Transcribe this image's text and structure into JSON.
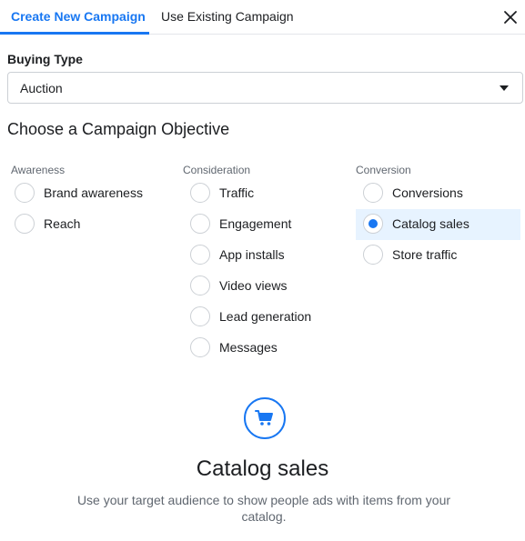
{
  "tabs": [
    {
      "label": "Create New Campaign",
      "active": true
    },
    {
      "label": "Use Existing Campaign",
      "active": false
    }
  ],
  "close_icon": "close-icon",
  "buying_type": {
    "label": "Buying Type",
    "value": "Auction"
  },
  "objective_title": "Choose a Campaign Objective",
  "columns": {
    "awareness": {
      "heading": "Awareness",
      "options": [
        "Brand awareness",
        "Reach"
      ]
    },
    "consideration": {
      "heading": "Consideration",
      "options": [
        "Traffic",
        "Engagement",
        "App installs",
        "Video views",
        "Lead generation",
        "Messages"
      ]
    },
    "conversion": {
      "heading": "Conversion",
      "options": [
        "Conversions",
        "Catalog sales",
        "Store traffic"
      ]
    }
  },
  "selected_objective": "Catalog sales",
  "detail": {
    "icon": "shopping-cart-icon",
    "title": "Catalog sales",
    "description": "Use your target audience to show people ads with items from your catalog."
  },
  "colors": {
    "accent": "#1877f2",
    "selected_bg": "#e7f3ff",
    "muted_text": "#606770"
  }
}
